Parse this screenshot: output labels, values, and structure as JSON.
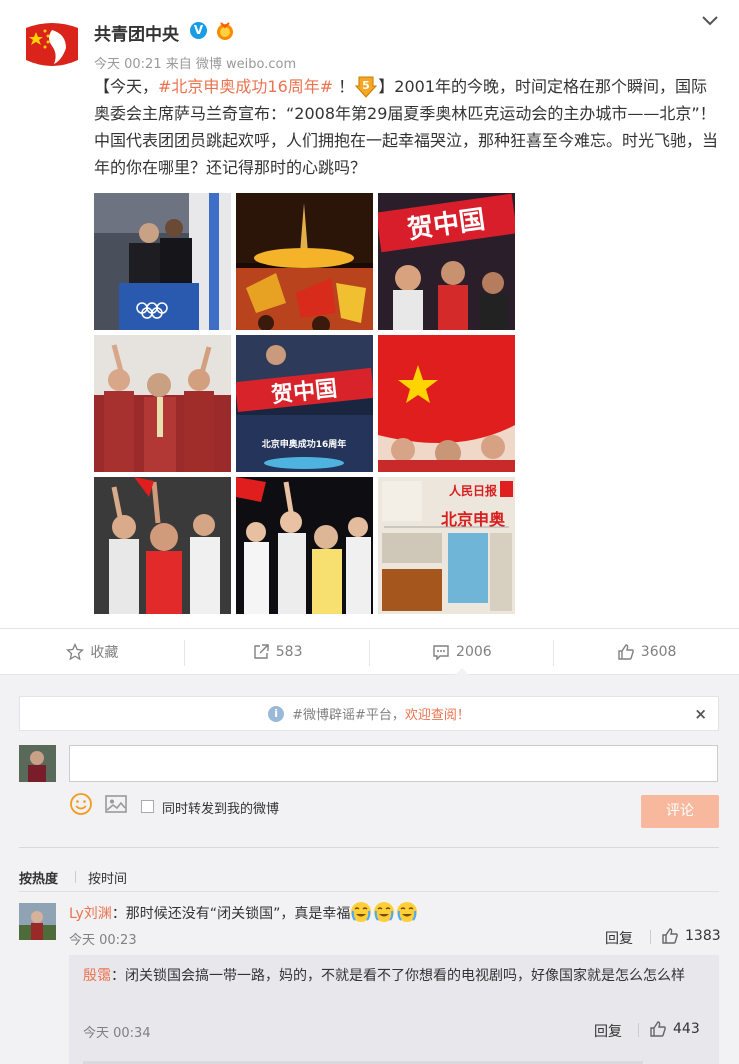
{
  "post": {
    "author": "共青团中央",
    "verified_badge": "V",
    "meta": "今天 00:21 来自 微博 weibo.com",
    "text_open": "【今天，",
    "text_tag": "#北京申奥成功16周年#",
    "text_after_tag": " ！",
    "text_rest": "】2001年的今晚，时间定格在那个瞬间，国际奥委会主席萨马兰奇宣布：“2008年第29届夏季奥林匹克运动会的主办城市——北京”！中国代表团团员跳起欢呼，人们拥抱在一起幸福哭泣，那种狂喜至今难忘。时光飞驰，当年的你在哪里？还记得那时的心跳吗？",
    "photo_caption": "北京申奥成功16周年",
    "photo_banner_text": "贺中国",
    "newspaper_title": "北京申奥",
    "newspaper_masthead": "人民日报"
  },
  "actions": {
    "favorite_label": "收藏",
    "repost_count": "583",
    "comment_count": "2006",
    "like_count": "3608"
  },
  "colors": {
    "accent": "#eb7350",
    "link": "#eb7350",
    "submit_button": "#f7b89d",
    "page_bg": "#f2f2f5"
  },
  "comment_box": {
    "rumor_tag": "#微博辟谣#",
    "rumor_mid": "平台，",
    "rumor_highlight": "欢迎查阅！",
    "rumor_close": "×",
    "input_value": "",
    "repost_checkbox_label": "同时转发到我的微博",
    "submit_label": "评论"
  },
  "sort": {
    "hot": "按热度",
    "time": "按时间"
  },
  "comments": [
    {
      "user": "Ly刘渊",
      "text": "：那时候还没有“闭关锁国”，真是幸福",
      "time": "今天 00:23",
      "reply_label": "回复",
      "likes": "1383",
      "reply": {
        "user": "殷霭",
        "text": "：闭关锁国会搞一带一路，妈的，不就是看不了你想看的电视剧吗，好像国家就是怎么怎么样",
        "time": "今天 00:34",
        "reply_label": "回复",
        "likes": "443"
      }
    }
  ],
  "icons": {
    "chevron": "chevron-down-icon",
    "star": "star-icon",
    "share": "share-icon",
    "comment": "comment-icon",
    "like": "thumb-up-icon",
    "info": "info-icon",
    "smile": "smile-icon",
    "image": "image-icon"
  }
}
